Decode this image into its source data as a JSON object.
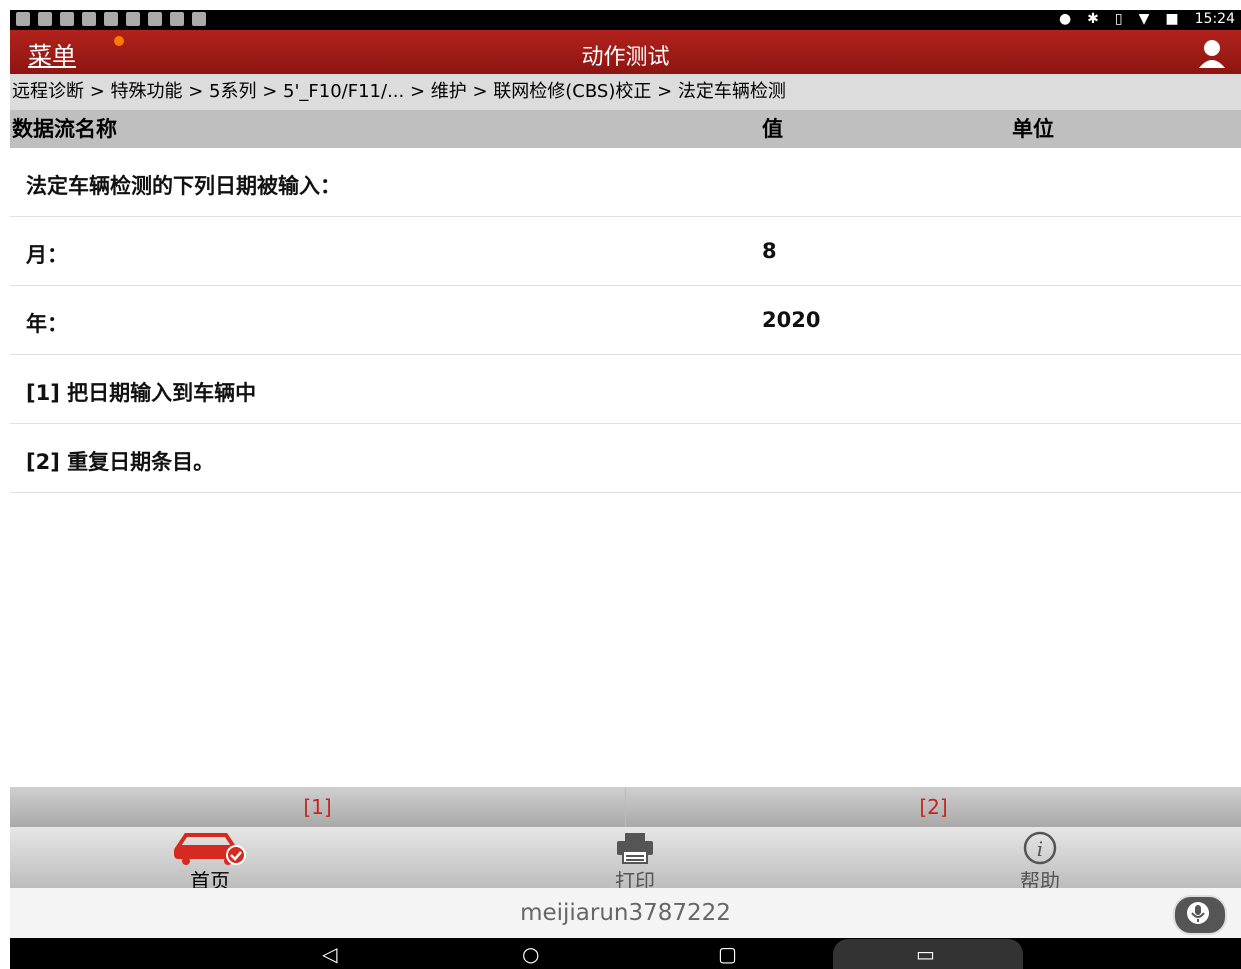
{
  "status_bar": {
    "time": "15:24"
  },
  "header": {
    "menu_label": "菜单",
    "title": "动作测试",
    "accent_color": "#a81b16"
  },
  "breadcrumb": {
    "text": "远程诊断 > 特殊功能 > 5系列 > 5'_F10/F11/... > 维护 > 联网检修(CBS)校正 > 法定车辆检测"
  },
  "table": {
    "columns": [
      "数据流名称",
      "值",
      "单位"
    ],
    "rows": [
      {
        "name": "法定车辆检测的下列日期被输入：",
        "value": ""
      },
      {
        "name": "月：",
        "value": "8"
      },
      {
        "name": "年：",
        "value": "2020"
      },
      {
        "name": "[1] 把日期输入到车辆中",
        "value": ""
      },
      {
        "name": "[2] 重复日期条目。",
        "value": ""
      }
    ]
  },
  "action_buttons": [
    "[1]",
    "[2]"
  ],
  "bottom_nav": [
    {
      "label": "首页",
      "icon": "car-icon"
    },
    {
      "label": "打印",
      "icon": "printer-icon"
    },
    {
      "label": "帮助",
      "icon": "info-icon"
    }
  ],
  "user_strip": {
    "username": "meijiarun3787222"
  }
}
